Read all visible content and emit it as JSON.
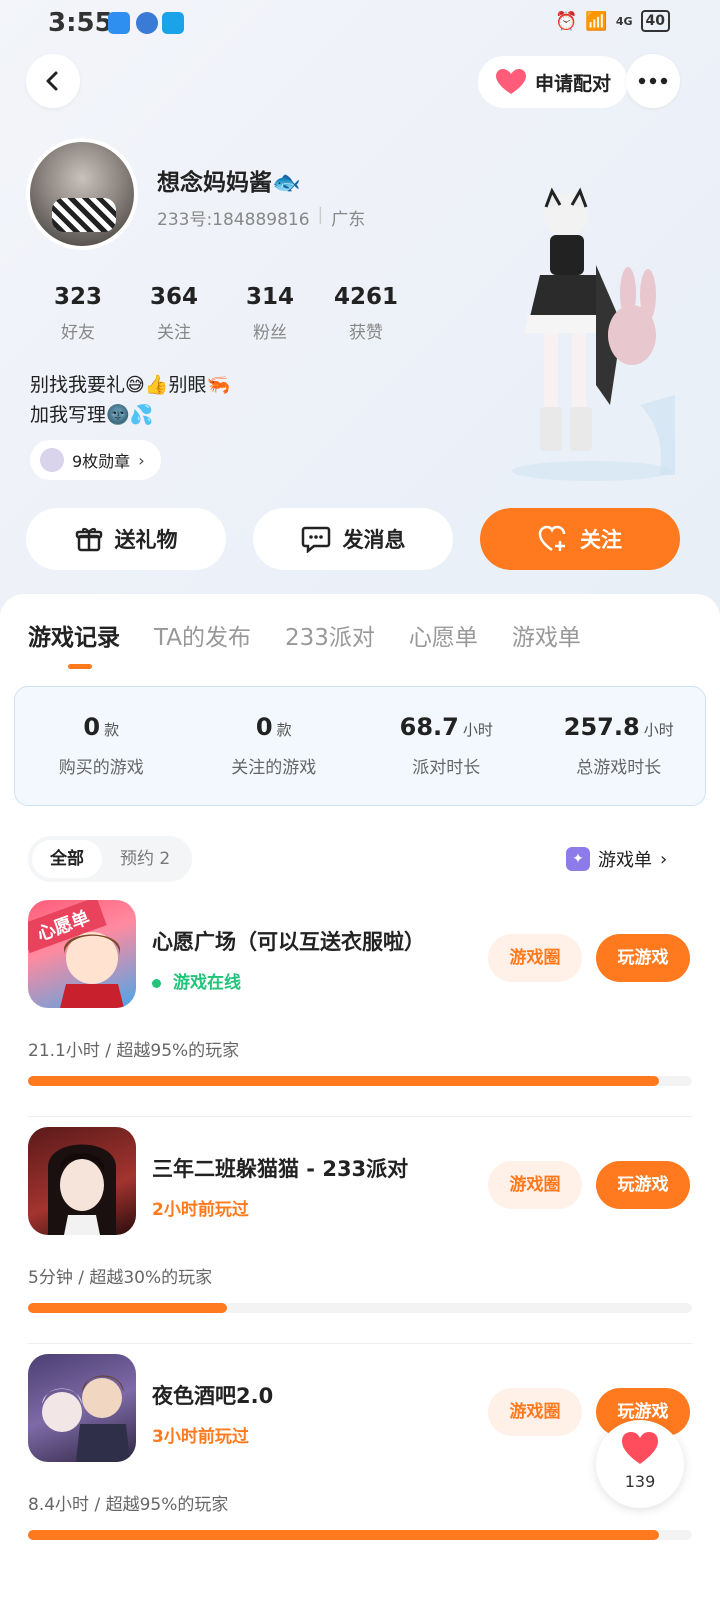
{
  "status_bar": {
    "time": "3:55",
    "battery": "40",
    "network": "4G"
  },
  "header": {
    "pair_label": "申请配对"
  },
  "profile": {
    "name": "想念妈妈酱🐟",
    "id_text": "233号:184889816",
    "location": "广东",
    "stats": [
      {
        "value": "323",
        "label": "好友"
      },
      {
        "value": "364",
        "label": "关注"
      },
      {
        "value": "314",
        "label": "粉丝"
      },
      {
        "value": "4261",
        "label": "获赞"
      }
    ],
    "bio_line1": "别找我要礼😅👍别眼🦐",
    "bio_line2": "加我写理🌚💦",
    "medal_label": "9枚勋章"
  },
  "actions": {
    "gift": "送礼物",
    "message": "发消息",
    "follow": "关注"
  },
  "tabs": [
    {
      "label": "游戏记录"
    },
    {
      "label": "TA的发布"
    },
    {
      "label": "233派对"
    },
    {
      "label": "心愿单"
    },
    {
      "label": "游戏单"
    }
  ],
  "summary": [
    {
      "value": "0",
      "unit": "款",
      "label": "购买的游戏"
    },
    {
      "value": "0",
      "unit": "款",
      "label": "关注的游戏"
    },
    {
      "value": "68.7",
      "unit": "小时",
      "label": "派对时长"
    },
    {
      "value": "257.8",
      "unit": "小时",
      "label": "总游戏时长"
    }
  ],
  "filter": {
    "all": "全部",
    "reserve": "预约 2",
    "game_list": "游戏单"
  },
  "games": [
    {
      "title": "心愿广场（可以互送衣服啦）",
      "status": "游戏在线",
      "meta": "21.1小时 / 超越95%的玩家",
      "progress": 0.95,
      "circle_label": "游戏圈",
      "play_label": "玩游戏",
      "icon_text": "心愿单"
    },
    {
      "title": "三年二班躲猫猫 - 233派对",
      "status": "2小时前玩过",
      "meta": "5分钟 / 超越30%的玩家",
      "progress": 0.3,
      "circle_label": "游戏圈",
      "play_label": "玩游戏",
      "icon_text": ""
    },
    {
      "title": "夜色酒吧2.0",
      "status": "3小时前玩过",
      "meta": "8.4小时 / 超越95%的玩家",
      "progress": 0.95,
      "circle_label": "游戏圈",
      "play_label": "玩游戏",
      "icon_text": ""
    }
  ],
  "float_like": {
    "count": "139"
  },
  "colors": {
    "accent": "#ff7a1f",
    "online": "#22c47a"
  }
}
